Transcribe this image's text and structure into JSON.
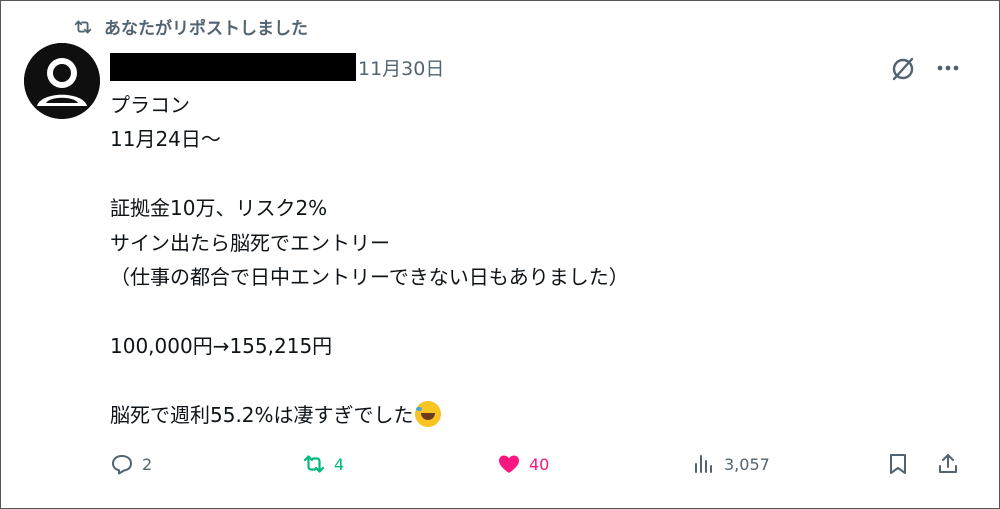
{
  "repost_header": {
    "text": "あなたがリポストしました"
  },
  "post": {
    "date": "11月30日",
    "lines": [
      "プラコン",
      "11月24日～",
      "",
      "証拠金10万、リスク2%",
      "サイン出たら脳死でエントリー",
      "（仕事の都合で日中エントリーできない日もありました）",
      "",
      "100,000円→155,215円",
      "",
      "脳死で週利55.2%は凄すぎでした"
    ],
    "emoji": "rolling-on-floor-laughing-emoji"
  },
  "actions": {
    "reply_count": "2",
    "repost_count": "4",
    "like_count": "40",
    "view_count": "3,057"
  },
  "colors": {
    "secondary_text": "#536471",
    "repost_active": "#00ba7c",
    "like_active": "#f91880"
  }
}
